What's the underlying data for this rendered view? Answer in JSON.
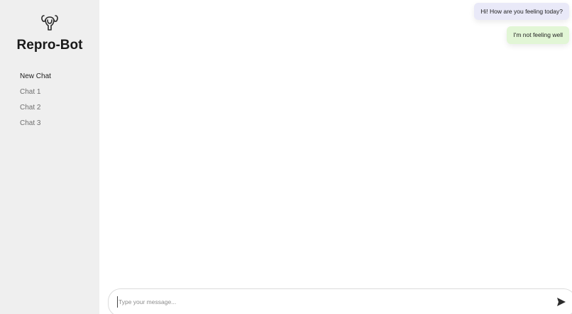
{
  "sidebar": {
    "logo_icon": "uterus-icon",
    "title": "Repro-Bot",
    "items": [
      {
        "label": "New Chat"
      },
      {
        "label": "Chat 1"
      },
      {
        "label": "Chat 2"
      },
      {
        "label": "Chat 3"
      }
    ]
  },
  "messages": [
    {
      "role": "bot",
      "text": "Hi! How are you feeling today?"
    },
    {
      "role": "user",
      "text": "I'm not feeling well"
    }
  ],
  "composer": {
    "placeholder": "Type your message...",
    "value": "",
    "send_icon": "send-icon"
  },
  "colors": {
    "sidebar_bg": "#efefef",
    "bot_bubble": "#e9e9f8",
    "user_bubble": "#e2f6d6"
  }
}
